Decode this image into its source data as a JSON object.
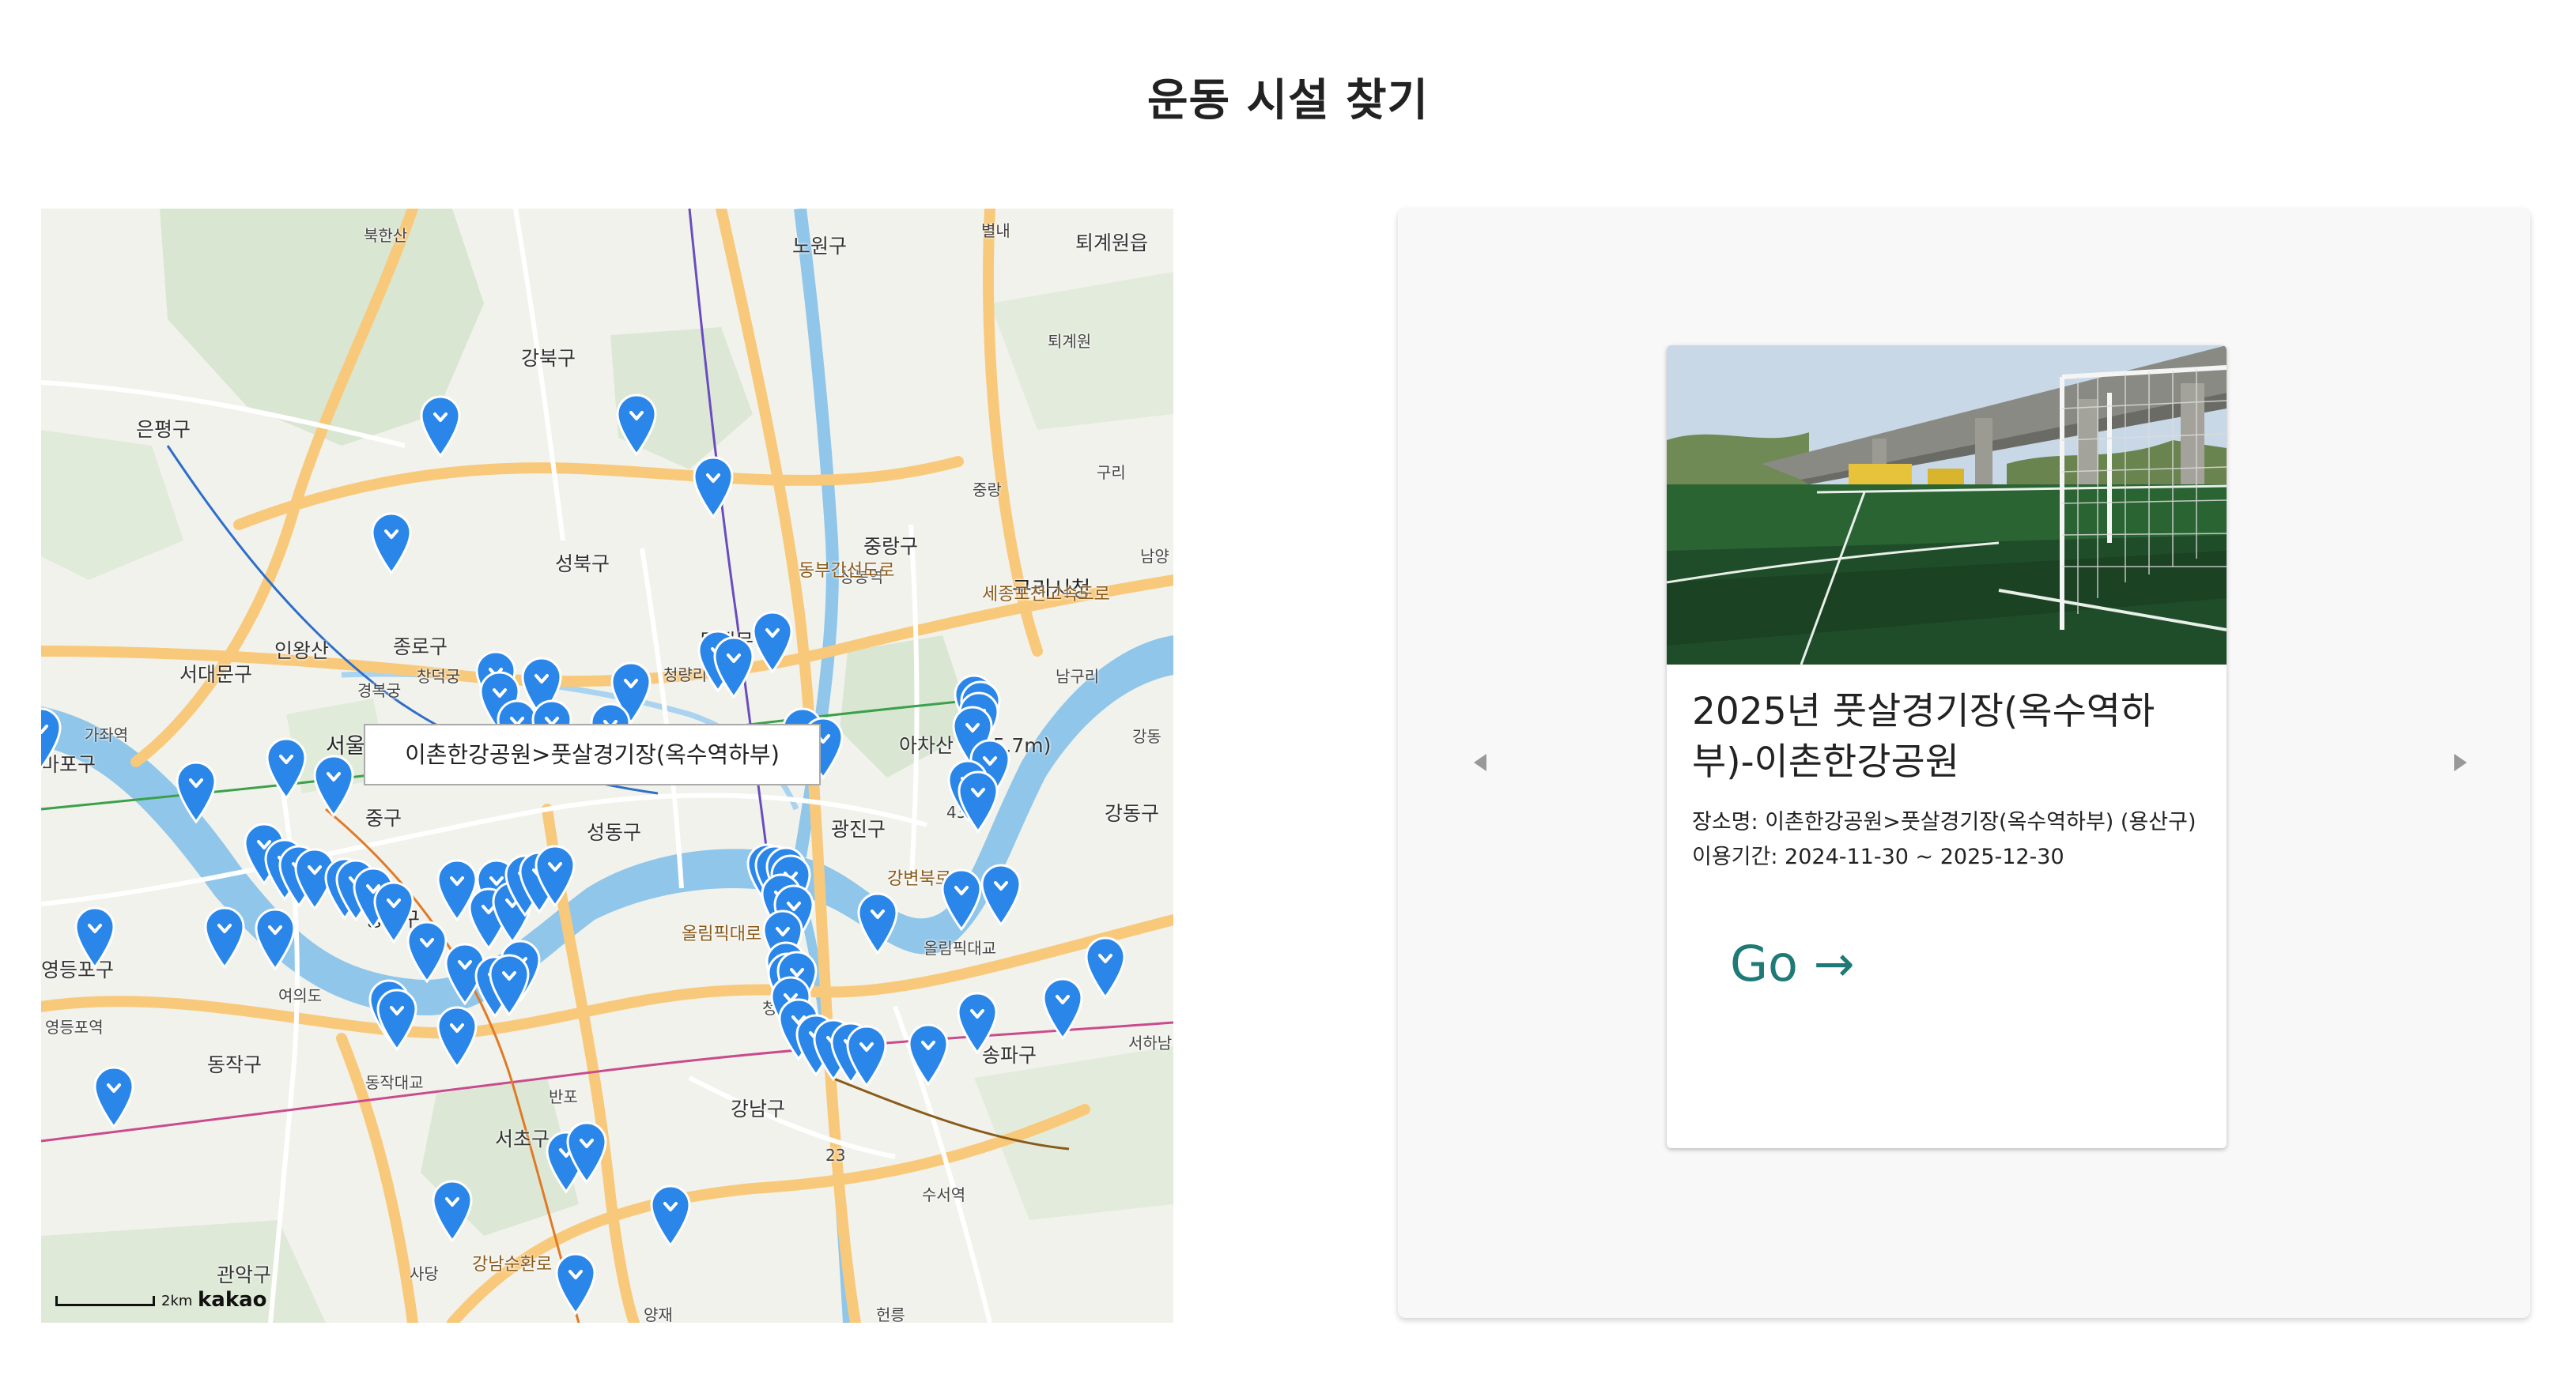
{
  "page": {
    "title": "운동 시설 찾기"
  },
  "map": {
    "info_window": "이촌한강공원>풋살경기장(옥수역하부)",
    "scale_label": "2km",
    "logo": "kakao",
    "labels": {
      "gangbuk": "강북구",
      "nowon": "노원구",
      "eunpyeong": "은평구",
      "seongbuk": "성북구",
      "jungnang": "중랑구",
      "jongno": "종로구",
      "seodaemun": "서대문구",
      "dongdaemun": "동대문구",
      "mapo": "마포구",
      "seoul": "서울",
      "junggu": "중구",
      "yongsan": "용산구",
      "seongdong": "성동구",
      "gwangjin": "광진구",
      "gangdong": "강동구",
      "yeongdeungpo": "영등포구",
      "dongjak": "동작구",
      "seocho": "서초구",
      "gangnam": "강남구",
      "songpa": "송파구",
      "gwanak": "관악구",
      "guri": "구리시청",
      "achasan": "아차산 (295.7m)",
      "bukhansan": "북한산",
      "inwangsan": "인왕산",
      "toegyewon": "퇴계원읍",
      "byeollae": "별내",
      "gyeongbokgung": "경복궁",
      "changdeokgung": "창덕궁",
      "cheongnyangni": "청량리역",
      "sangbong": "상봉역",
      "yeouido": "여의도",
      "suseo": "수서역",
      "namguri": "남구리",
      "hanam": "서하남",
      "cheongdam": "청담",
      "olympic": "올림픽대교",
      "banpo": "반포",
      "yangjae": "양재",
      "sadang": "사당",
      "dongjakbridge": "동작대교",
      "gayang": "가좌역",
      "yeongdeungpo_st": "영등포역",
      "gangbyeon": "강변북로",
      "olympic_rd": "올림픽대로",
      "dongbu": "동부간선도로",
      "sejong": "세종포천고속도로",
      "gangnamsunhwan": "강남순환로",
      "hyeollleung": "헌릉",
      "jungrang_ic": "중랑",
      "toegyewon_ic": "퇴계원",
      "guri_ic": "구리",
      "namyang": "남양",
      "gangil": "강동",
      "route43": "43",
      "route23": "23"
    }
  },
  "carousel": {
    "prev_label": "◀",
    "next_label": "▶",
    "card": {
      "title": "2025년 풋살경기장(옥수역하부)-이촌한강공원",
      "location": "장소명: 이촌한강공원>풋살경기장(옥수역하부) (용산구)",
      "period": "이용기간: 2024-11-30 ~ 2025-12-30",
      "go_label": "Go →"
    }
  },
  "colors": {
    "marker": "#2a86e8",
    "river": "#8fc6ea",
    "road_major": "#f9c97b",
    "accent_go": "#1e7a76"
  }
}
